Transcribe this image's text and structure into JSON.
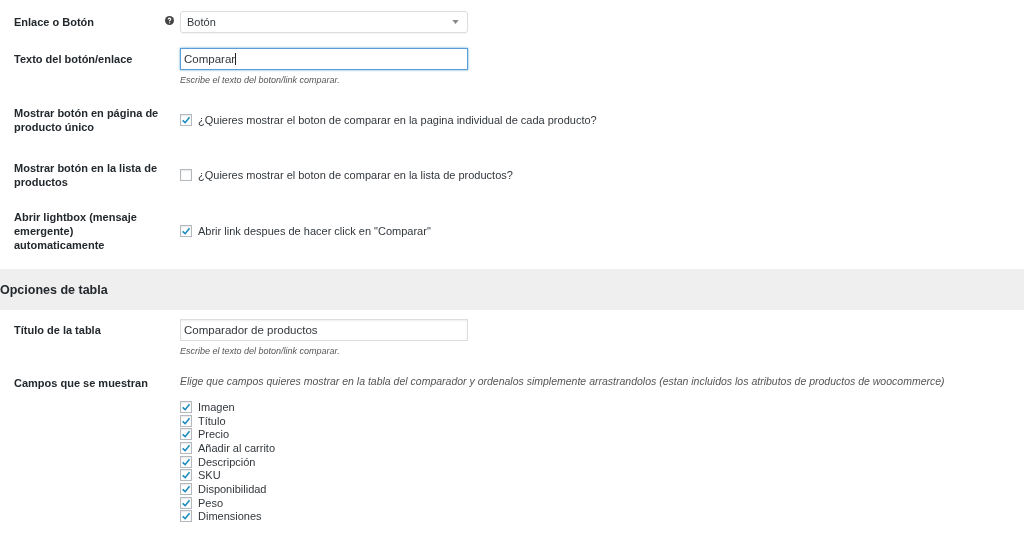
{
  "sections": [
    {
      "rows": [
        {
          "kind": "select",
          "label": "Enlace o Botón",
          "help": true,
          "value": "Botón"
        },
        {
          "kind": "text",
          "label": "Texto del botón/enlace",
          "value": "Comparar",
          "focused": true,
          "description": "Escribe el texto del boton/link comparar."
        },
        {
          "kind": "checkbox",
          "label": "Mostrar botón en página de producto único",
          "checked": true,
          "text": "¿Quieres mostrar el boton de comparar en la pagina individual de cada producto?"
        },
        {
          "kind": "checkbox",
          "label": "Mostrar botón en la lista de productos",
          "checked": false,
          "text": "¿Quieres mostrar el boton de comparar en la lista de productos?"
        },
        {
          "kind": "checkbox",
          "label": "Abrir lightbox (mensaje emergente) automaticamente",
          "checked": true,
          "text": "Abrir link despues de hacer click en \"Comparar\""
        }
      ]
    },
    {
      "heading": "Opciones de tabla",
      "rows": [
        {
          "kind": "text",
          "label": "Título de la tabla",
          "value": "Comparador de productos",
          "focused": false,
          "description": "Escribe el texto del boton/link comparar."
        },
        {
          "kind": "checklist",
          "label": "Campos que se muestran",
          "description": "Elige que campos quieres mostrar en la tabla del comparador y ordenalos simplemente arrastrandolos (estan incluidos los atributos de productos de woocommerce)",
          "items": [
            {
              "label": "Imagen",
              "checked": true
            },
            {
              "label": "Título",
              "checked": true
            },
            {
              "label": "Precio",
              "checked": true
            },
            {
              "label": "Añadir al carrito",
              "checked": true
            },
            {
              "label": "Descripción",
              "checked": true
            },
            {
              "label": "SKU",
              "checked": true
            },
            {
              "label": "Disponibilidad",
              "checked": true
            },
            {
              "label": "Peso",
              "checked": true
            },
            {
              "label": "Dimensiones",
              "checked": true
            }
          ]
        }
      ]
    }
  ]
}
